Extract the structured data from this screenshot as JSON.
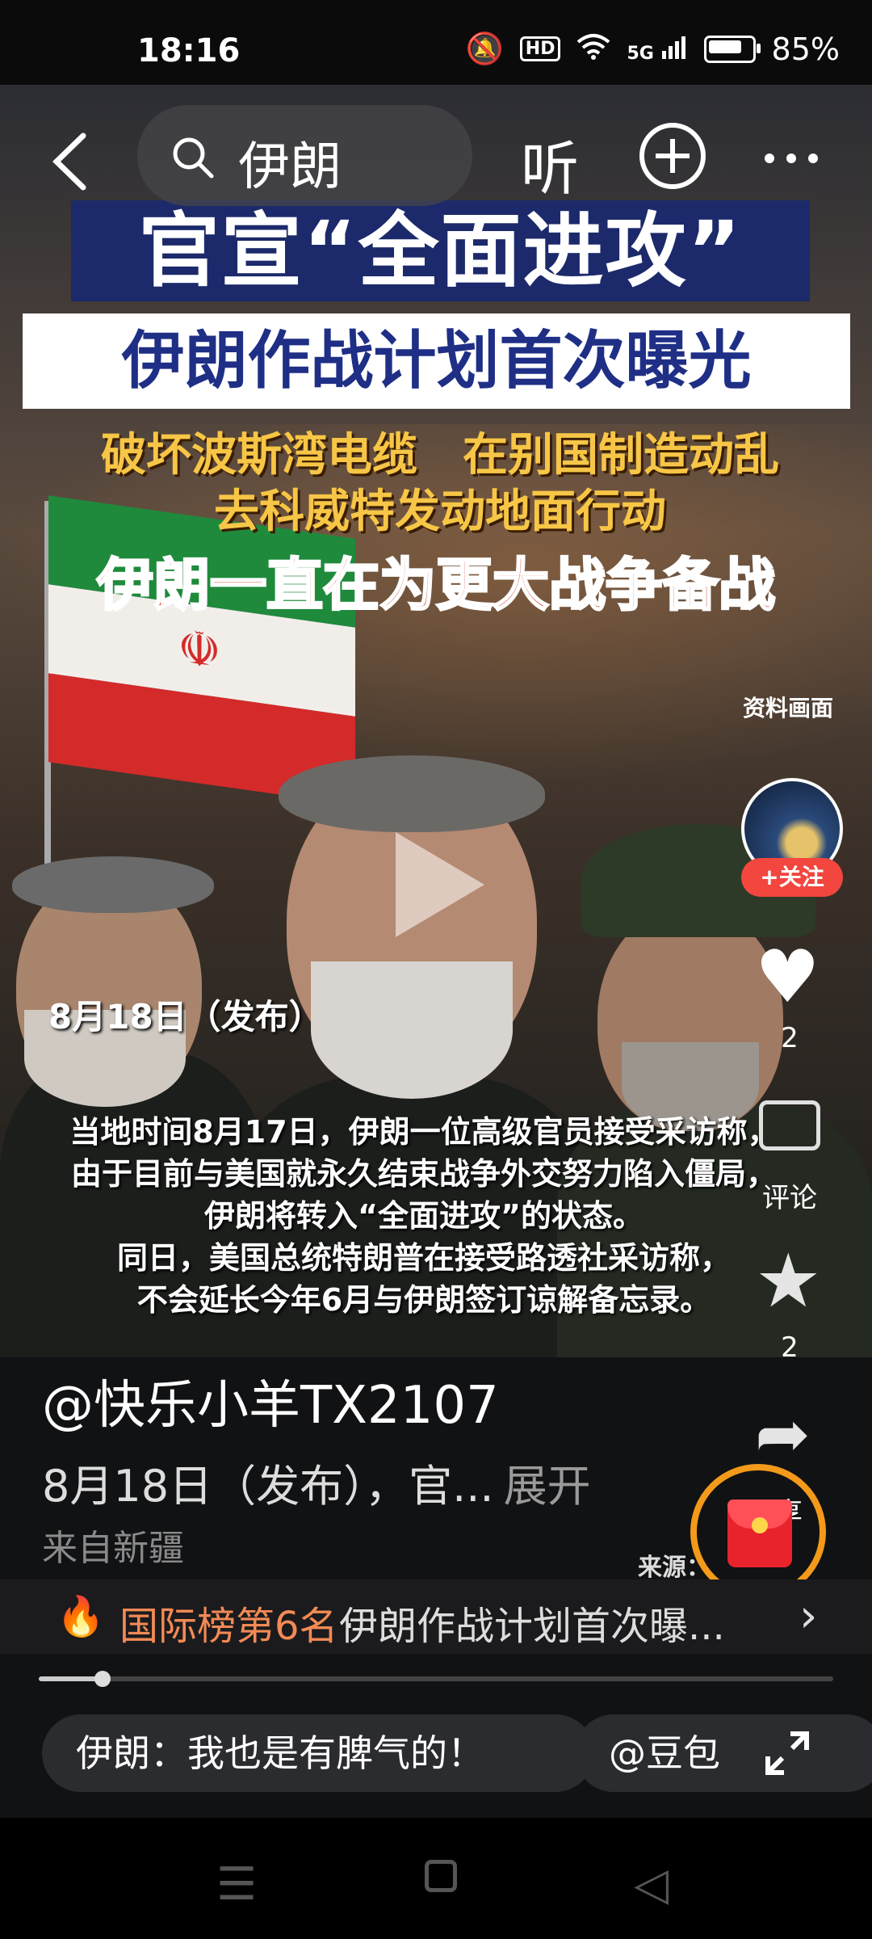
{
  "status_bar": {
    "time": "18:16",
    "hd": "HD",
    "network": "5G",
    "battery": "85%"
  },
  "top_bar": {
    "back_icon": "back-arrow-icon",
    "search_query": "伊朗",
    "listen_label": "听",
    "add_icon": "plus-circle-icon",
    "more_icon": "more-dots-icon"
  },
  "video": {
    "headline_1": "官宣“全面进攻”",
    "headline_2": "伊朗作战计划首次曝光",
    "subline_1": "破坏波斯湾电缆　在别国制造动乱",
    "subline_2": "去科威特发动地面行动",
    "subline_3": "伊朗一直在为更大战争备战",
    "archive_label": "资料画面",
    "date_tag": "8月18日（发布）",
    "caption_lines": [
      "当地时间8月17日，伊朗一位高级官员接受采访称，",
      "由于目前与美国就永久结束战争外交努力陷入僵局，",
      "伊朗将转入“全面进攻”的状态。",
      "同日，美国总统特朗普在接受路透社采访称，",
      "不会延长今年6月与伊朗签订谅解备忘录。"
    ],
    "source_label": "来源："
  },
  "actions": {
    "follow_label": "+关注",
    "like_count": "2",
    "comment_label": "评论",
    "favorite_count": "2",
    "share_label": "享"
  },
  "post": {
    "author": "@快乐小羊TX2107",
    "description": "8月18日（发布），官...",
    "expand_label": "展开",
    "location": "来自新疆"
  },
  "ranking": {
    "name": "国际榜第6名",
    "separator": "·",
    "title": "伊朗作战计划首次曝..."
  },
  "progress": {
    "fraction": 0.08
  },
  "chips": [
    "伊朗：我也是有脾气的！",
    "@豆包"
  ],
  "colors": {
    "banner_blue": "#1c2a6b",
    "follow_red": "#f2463f",
    "rank_orange": "#f28a55",
    "redpacket_ring": "#f39a1a"
  }
}
